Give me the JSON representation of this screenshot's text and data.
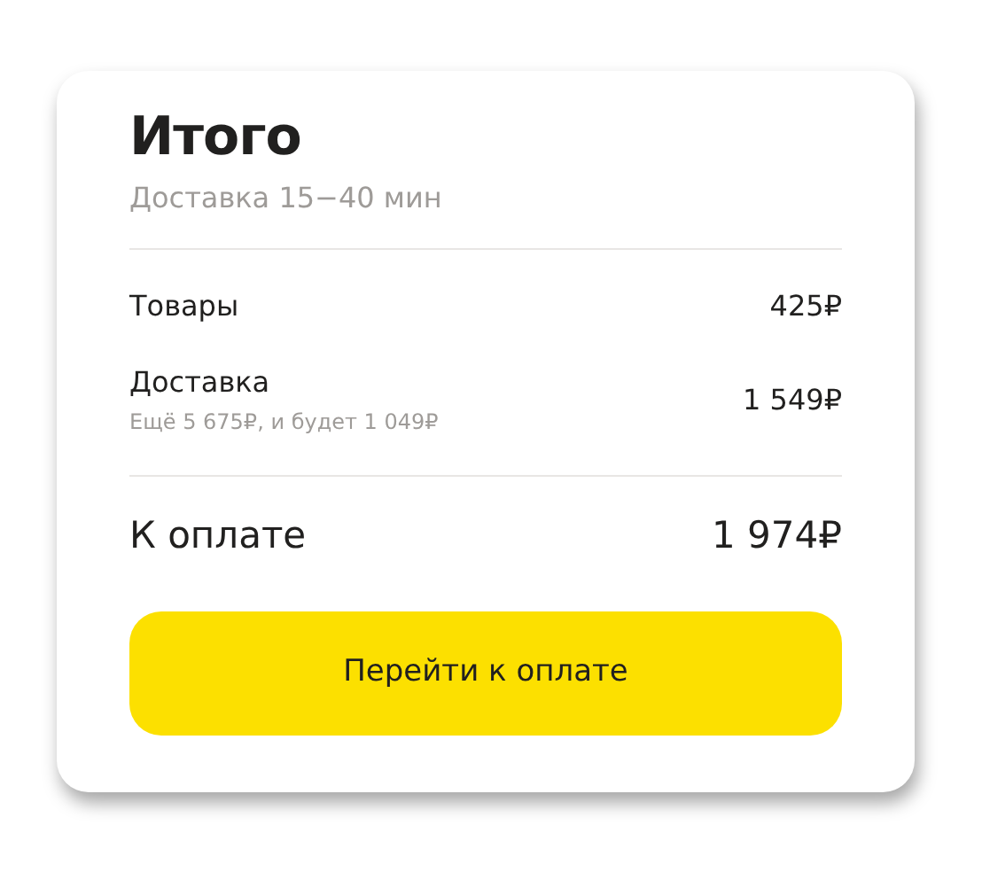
{
  "summary": {
    "title": "Итого",
    "subtitle": "Доставка 15−40 мин"
  },
  "lines": [
    {
      "label": "Товары",
      "amount": "425₽"
    },
    {
      "label": "Доставка",
      "note": "Ещё 5 675₽, и будет 1 049₽",
      "amount": "1 549₽"
    }
  ],
  "total": {
    "label": "К оплате",
    "amount": "1 974₽"
  },
  "button": {
    "label": "Перейти к оплате"
  }
}
